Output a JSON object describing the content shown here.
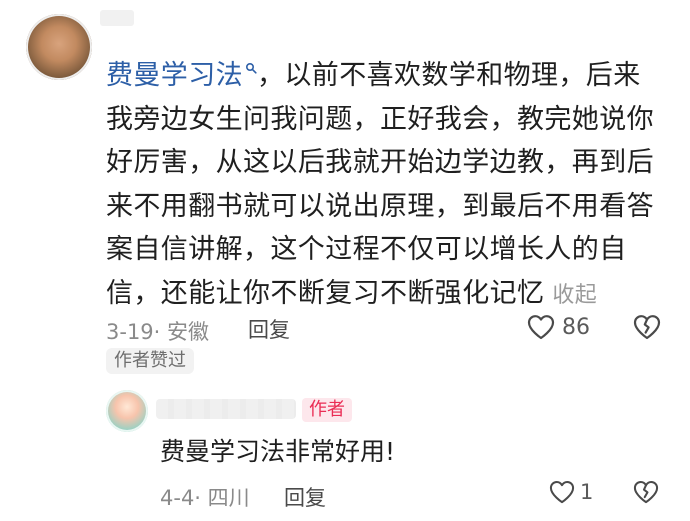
{
  "comment": {
    "mention": "费曼学习法",
    "text_after_mention": "，以前不喜欢数学和物理，后来我旁边女生问我问题，正好我会，教完她说你好厉害，从这以后我就开始边学边教，再到后来不用翻书就可以说出原理，到最后不用看答案自信讲解，这个过程不仅可以增长人的自信，还能让你不断复习不断强化记忆",
    "collapse_label": "收起",
    "date_location": "3-19· 安徽",
    "reply_label": "回复",
    "like_count": "86",
    "author_liked_badge": "作者赞过"
  },
  "reply": {
    "author_tag": "作者",
    "text": "费曼学习法非常好用!",
    "date_location": "4-4· 四川",
    "reply_label": "回复",
    "like_count": "1"
  },
  "icons": {
    "search": "search-icon",
    "heart": "heart-icon",
    "broken_heart": "broken-heart-icon"
  },
  "colors": {
    "mention": "#2d5fa7",
    "author_tag_bg": "#fde7ec",
    "author_tag_text": "#ea2d55",
    "meta_text": "#8a8a8a"
  }
}
